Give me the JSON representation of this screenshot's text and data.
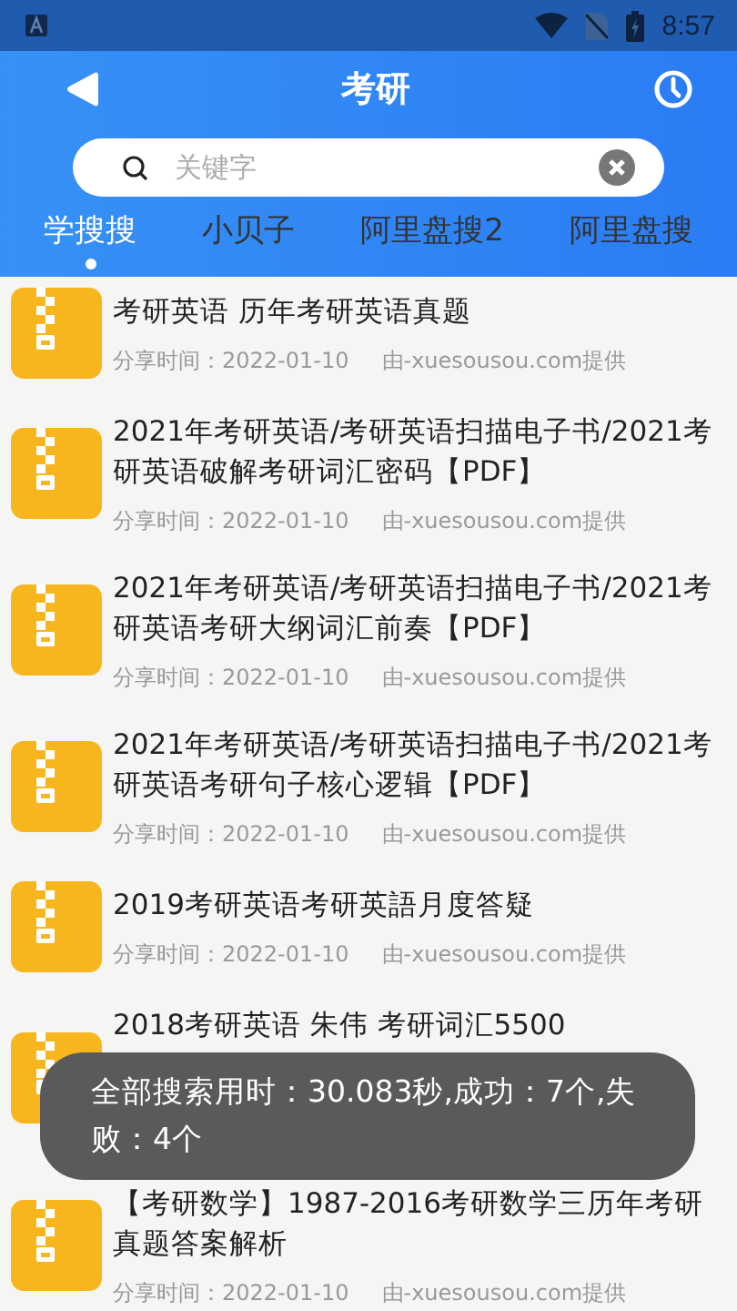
{
  "status_bar": {
    "time": "8:57"
  },
  "header": {
    "title": "考研"
  },
  "search": {
    "placeholder": "关键字"
  },
  "tabs": [
    {
      "label": "学搜搜",
      "selected": true
    },
    {
      "label": "小贝子",
      "selected": false
    },
    {
      "label": "阿里盘搜2",
      "selected": false
    },
    {
      "label": "阿里盘搜",
      "selected": false
    }
  ],
  "results": [
    {
      "title": "考研英语 历年考研英语真题",
      "share_time": "分享时间：2022-01-10",
      "source": "由-xuesousou.com提供"
    },
    {
      "title": "2021年考研英语/考研英语扫描电子书/2021考研英语破解考研词汇密码【PDF】",
      "share_time": "分享时间：2022-01-10",
      "source": "由-xuesousou.com提供"
    },
    {
      "title": "2021年考研英语/考研英语扫描电子书/2021考研英语考研大纲词汇前奏【PDF】",
      "share_time": "分享时间：2022-01-10",
      "source": "由-xuesousou.com提供"
    },
    {
      "title": "2021年考研英语/考研英语扫描电子书/2021考研英语考研句子核心逻辑【PDF】",
      "share_time": "分享时间：2022-01-10",
      "source": "由-xuesousou.com提供"
    },
    {
      "title": "2019考研英语考研英語月度答疑",
      "share_time": "分享时间：2022-01-10",
      "source": "由-xuesousou.com提供"
    },
    {
      "title": "2018考研英语 朱伟 考研词汇5500"
    },
    {
      "title": "【考研数学】1987-2016考研数学三历年考研真题答案解析",
      "share_time": "分享时间：2022-01-10",
      "source": "由-xuesousou.com提供"
    }
  ],
  "toast": "全部搜索用时：30.083秒,成功：7个,失败：4个"
}
